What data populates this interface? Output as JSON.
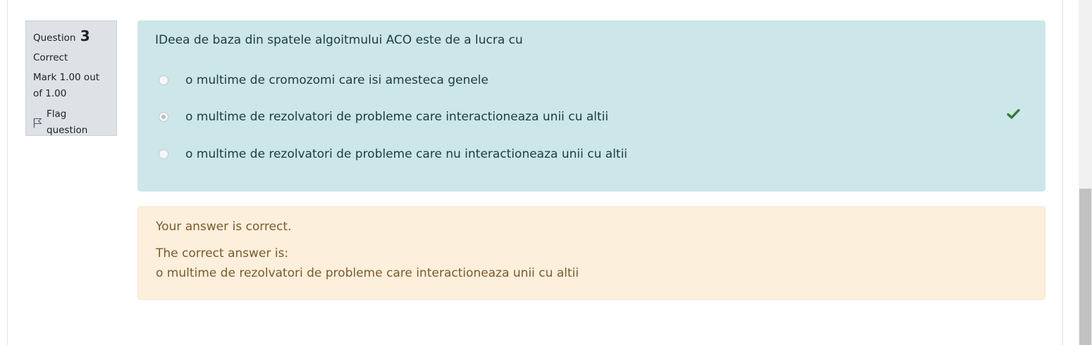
{
  "question": {
    "label": "Question",
    "number": "3",
    "state": "Correct",
    "grade": "Mark 1.00 out of 1.00",
    "flag_label": "Flag question",
    "text": "IDeea de baza din spatele algoitmului ACO este de a lucra cu",
    "answers": [
      {
        "label": "o multime de cromozomi care isi amesteca genele",
        "selected": false
      },
      {
        "label": "o multime de rezolvatori de probleme care interactioneaza unii cu altii",
        "selected": true,
        "correct": true
      },
      {
        "label": "o multime de rezolvatori de probleme care nu interactioneaza unii cu altii",
        "selected": false
      }
    ]
  },
  "feedback": {
    "result": "Your answer is correct.",
    "correct_intro": "The correct answer is:",
    "correct_answer": "o multime de rezolvatori de probleme care interactioneaza unii cu altii"
  },
  "colors": {
    "formulation_bg": "#cce6ea",
    "feedback_bg": "#fcefdc",
    "info_bg": "#dee2e6",
    "correct_check": "#357a32"
  },
  "icons": {
    "flag": "flag-icon",
    "correct": "check-icon"
  }
}
